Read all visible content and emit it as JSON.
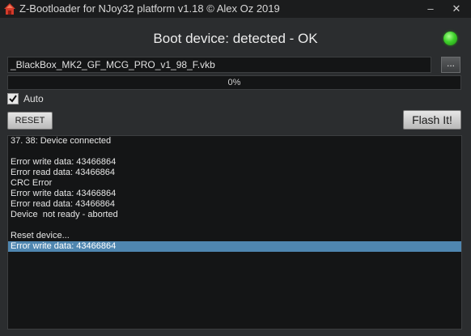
{
  "window": {
    "title": "Z-Bootloader for NJoy32 platform v1.18 © Alex Oz 2019",
    "minimize_glyph": "–",
    "close_glyph": "✕",
    "app_icon": "red-house-icon"
  },
  "status": {
    "text": "Boot device: detected - OK",
    "led_color": "#3fd22b"
  },
  "file": {
    "path": "_BlackBox_MK2_GF_MCG_PRO_v1_98_F.vkb",
    "browse_label": "..."
  },
  "progress": {
    "value": 0,
    "label": "0%"
  },
  "auto": {
    "label": "Auto",
    "checked": true
  },
  "buttons": {
    "reset_label": "RESET",
    "flash_label": "Flash It!"
  },
  "log": {
    "lines": [
      "37. 38: Device connected",
      "",
      "Error write data: 43466864",
      "Error read data: 43466864",
      "CRC Error",
      "Error write data: 43466864",
      "Error read data: 43466864",
      "Device  not ready - aborted",
      "",
      "Reset device...",
      "Error write data: 43466864"
    ],
    "selected_index": 10,
    "selection_color": "#4f86b0"
  }
}
